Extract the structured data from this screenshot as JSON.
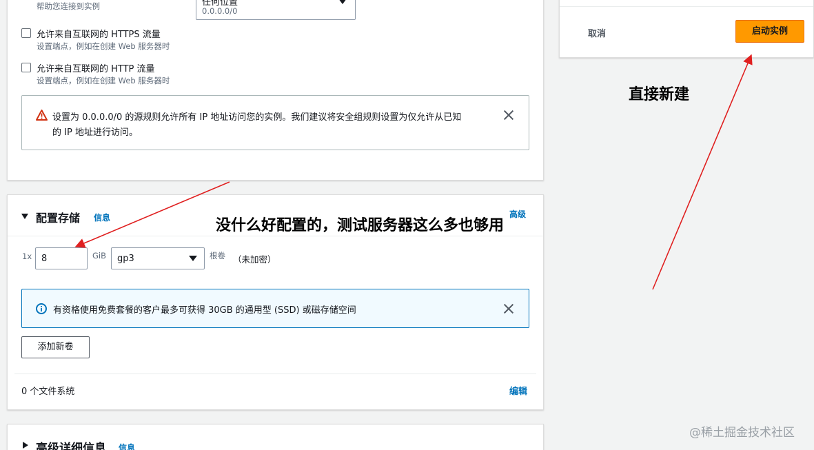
{
  "security_group": {
    "prev_desc": "帮助您连接到实例",
    "source_select_value": "任何位置",
    "source_select_sub": "0.0.0.0/0",
    "https": {
      "label": "允许来自互联网的 HTTPS 流量",
      "desc": "设置端点，例如在创建 Web 服务器时"
    },
    "http": {
      "label": "允许来自互联网的 HTTP 流量",
      "desc": "设置端点，例如在创建 Web 服务器时"
    },
    "warning_line1": "设置为 0.0.0.0/0 的源规则允许所有 IP 地址访问您的实例。我们建议将安全组规则设置为仅允许从已知",
    "warning_line2": "的 IP 地址进行访问。"
  },
  "storage": {
    "title": "配置存储",
    "info_link": "信息",
    "advanced_link": "高级",
    "multiplier": "1x",
    "size_value": "8",
    "unit": "GiB",
    "volume_type": "gp3",
    "root_label": "根卷",
    "encryption": "（未加密）",
    "info_text": "有资格使用免费套餐的客户最多可获得 30GB 的通用型 (SSD) 或磁存储空间",
    "add_volume_button": "添加新卷",
    "file_systems": "0 个文件系统",
    "edit_link": "编辑"
  },
  "advanced": {
    "title": "高级详细信息",
    "info_link": "信息"
  },
  "summary": {
    "cancel": "取消",
    "launch": "启动实例"
  },
  "annotations": {
    "direct_create": "直接新建",
    "storage_note": "没什么好配置的，测试服务器这么多也够用"
  },
  "watermark": "@稀土掘金技术社区",
  "colors": {
    "primary_button": "#ff9900",
    "link": "#0073bb",
    "warning_icon": "#d13212",
    "info_icon": "#0073bb",
    "annotation_arrow": "#e02020"
  }
}
